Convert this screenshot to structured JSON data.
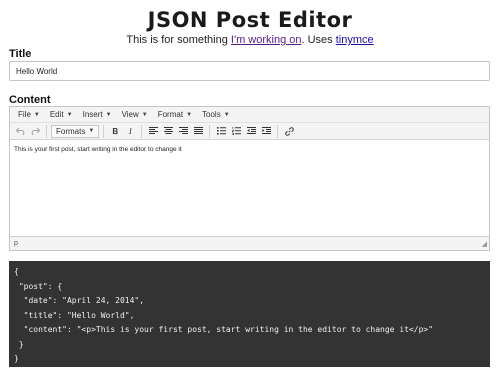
{
  "header": {
    "title": "JSON Post Editor",
    "subtitle_prefix": "This is for something ",
    "subtitle_link1": "I'm working on",
    "subtitle_middle": ". Uses ",
    "subtitle_link2": "tinymce"
  },
  "title_field": {
    "label": "Title",
    "value": "Hello World"
  },
  "content_field": {
    "label": "Content"
  },
  "editor": {
    "menus": [
      {
        "label": "File"
      },
      {
        "label": "Edit"
      },
      {
        "label": "Insert"
      },
      {
        "label": "View"
      },
      {
        "label": "Format"
      },
      {
        "label": "Tools"
      }
    ],
    "formats_label": "Formats",
    "bold_label": "B",
    "italic_label": "I",
    "body_text": "This is your first post, start writing in the editor to change it",
    "status_path": "p",
    "icons": [
      "undo-icon",
      "redo-icon",
      "align-left-icon",
      "align-center-icon",
      "align-right-icon",
      "align-justify-icon",
      "bullet-list-icon",
      "numbered-list-icon",
      "outdent-icon",
      "indent-icon",
      "link-icon"
    ]
  },
  "json_output": {
    "lines": [
      "{",
      " \"post\": {",
      "  \"date\": \"April 24, 2014\",",
      "  \"title\": \"Hello World\",",
      "  \"content\": \"<p>This is your first post, start writing in the editor to change it</p>\"",
      " }",
      "}"
    ]
  },
  "colors": {
    "json_background": "#333333",
    "link": "#1a0dab",
    "visited_link": "#551a8b"
  }
}
